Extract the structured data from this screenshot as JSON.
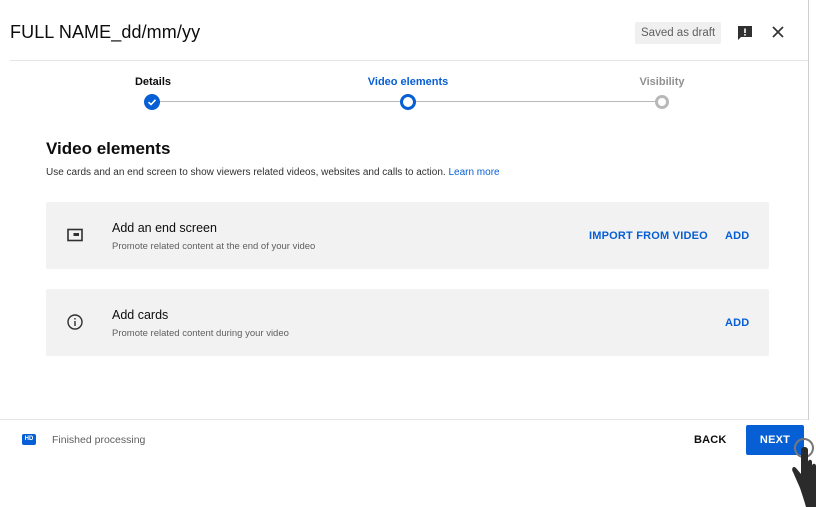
{
  "header": {
    "title": "FULL NAME_dd/mm/yy",
    "draft_badge": "Saved as draft",
    "feedback_icon": "feedback-icon",
    "close_icon": "close-icon"
  },
  "stepper": {
    "steps": [
      {
        "label": "Details",
        "state": "done"
      },
      {
        "label": "Video elements",
        "state": "current"
      },
      {
        "label": "Visibility",
        "state": "todo"
      }
    ]
  },
  "section": {
    "title": "Video elements",
    "description": "Use cards and an end screen to show viewers related videos, websites and calls to action.",
    "learn_more": "Learn more"
  },
  "cards": [
    {
      "icon": "end-screen-icon",
      "title": "Add an end screen",
      "subtitle": "Promote related content at the end of your video",
      "secondary_action": "IMPORT FROM VIDEO",
      "action": "ADD"
    },
    {
      "icon": "info-icon",
      "title": "Add cards",
      "subtitle": "Promote related content during your video",
      "action": "ADD"
    }
  ],
  "footer": {
    "hd_badge": "HD",
    "status": "Finished processing",
    "back_label": "BACK",
    "next_label": "NEXT"
  },
  "colors": {
    "accent": "#065fd4",
    "card_bg": "#f2f2f2",
    "inactive": "#b8b8b8"
  }
}
